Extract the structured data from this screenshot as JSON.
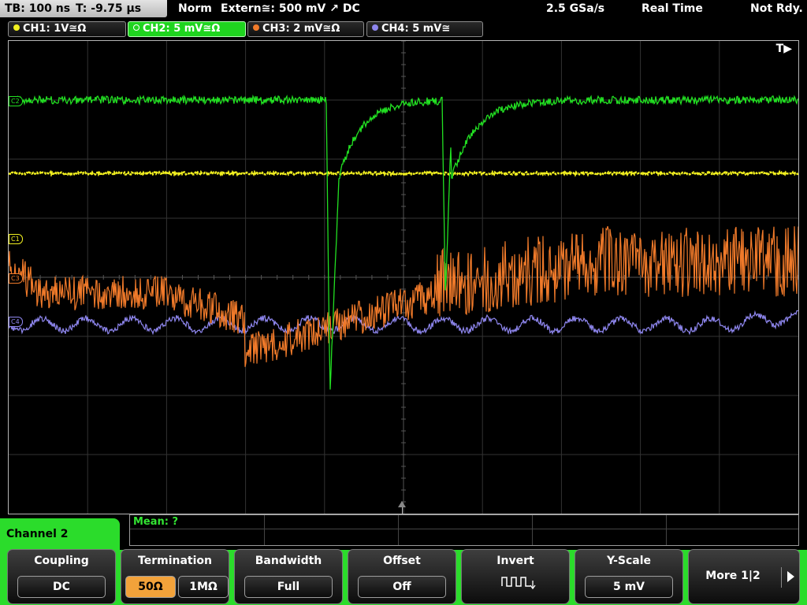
{
  "status": {
    "timebase": "TB: 100 ns",
    "trigger_time": "T: -9.75 µs",
    "mode": "Norm",
    "trigger_source": "Extern≅: 500 mV ↗ DC",
    "sample_rate": "2.5 GSa/s",
    "acquisition": "Real Time",
    "state": "Not Rdy."
  },
  "channels": [
    {
      "label": "CH1: 1V≅Ω",
      "color": "#f2f020",
      "marker": "C1"
    },
    {
      "label": "CH2: 5 mV≅Ω",
      "color": "#22e022",
      "marker": "C2"
    },
    {
      "label": "CH3: 2 mV≅Ω",
      "color": "#f07a2a",
      "marker": "C3"
    },
    {
      "label": "CH4: 5 mV≅",
      "color": "#8e86ee",
      "marker": "C4"
    }
  ],
  "trigger_marker": "T▶",
  "measurement": {
    "label": "Mean: ?"
  },
  "menu": {
    "title": "Channel 2",
    "coupling": {
      "label": "Coupling",
      "value": "DC"
    },
    "termination": {
      "label": "Termination",
      "options": [
        "50Ω",
        "1MΩ"
      ],
      "selected": 0
    },
    "bandwidth": {
      "label": "Bandwidth",
      "value": "Full"
    },
    "offset": {
      "label": "Offset",
      "value": "Off"
    },
    "invert": {
      "label": "Invert",
      "icon": "inverted-square-wave-icon"
    },
    "yscale": {
      "label": "Y-Scale",
      "value": "5 mV"
    },
    "more": {
      "label": "More 1|2",
      "icon": "chevron-right-icon"
    }
  },
  "colors": {
    "menu_accent": "#2bdc2b",
    "grid": "#3a3a3a",
    "termination_selected": "#f2a23a"
  }
}
